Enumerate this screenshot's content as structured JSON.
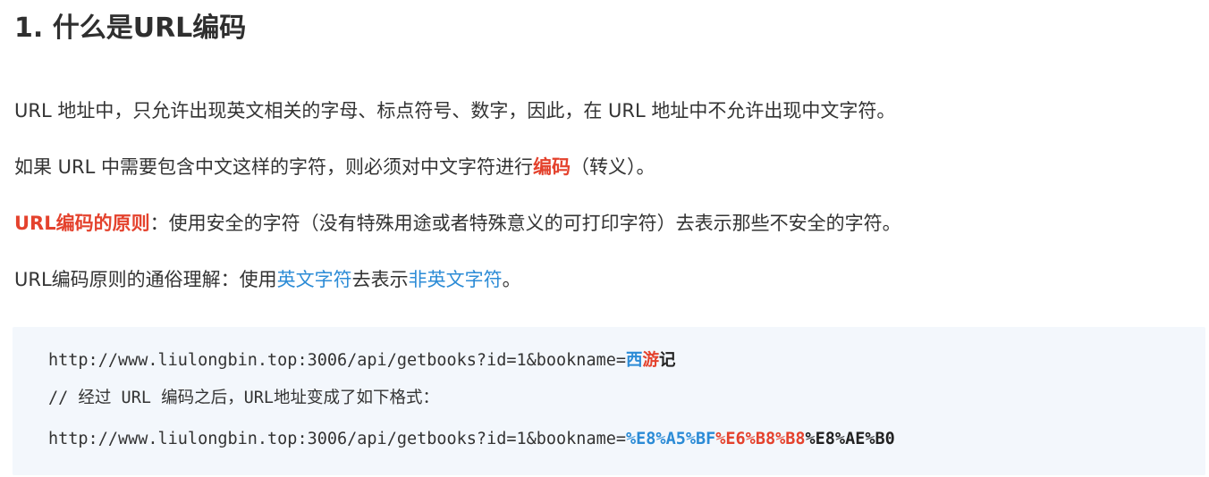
{
  "heading": "1. 什么是URL编码",
  "paragraphs": {
    "p1": "URL 地址中，只允许出现英文相关的字母、标点符号、数字，因此，在 URL 地址中不允许出现中文字符。",
    "p2": {
      "before": "如果 URL 中需要包含中文这样的字符，则必须对中文字符进行",
      "highlight": "编码",
      "after": "（转义）。"
    },
    "p3": {
      "highlight": "URL编码的原则",
      "after": "：使用安全的字符（没有特殊用途或者特殊意义的可打印字符）去表示那些不安全的字符。"
    },
    "p4": {
      "before": "URL编码原则的通俗理解：使用",
      "link1": "英文字符",
      "middle": "去表示",
      "link2": "非英文字符",
      "after": "。"
    }
  },
  "code": {
    "line1": {
      "url": "http://www.liulongbin.top:3006/api/getbooks?id=1&bookname=",
      "ch1": "西",
      "ch2": "游",
      "ch3": "记"
    },
    "line2": "// 经过 URL 编码之后，URL地址变成了如下格式：",
    "line3": {
      "url": "http://www.liulongbin.top:3006/api/getbooks?id=1&bookname=",
      "enc1": "%E8%A5%BF",
      "enc2": "%E6%B8%B8",
      "enc3": "%E8%AE%B0"
    }
  },
  "colors": {
    "accent_red": "#e4422d",
    "accent_blue": "#2b8bd6",
    "code_background": "#f3f7fc"
  }
}
